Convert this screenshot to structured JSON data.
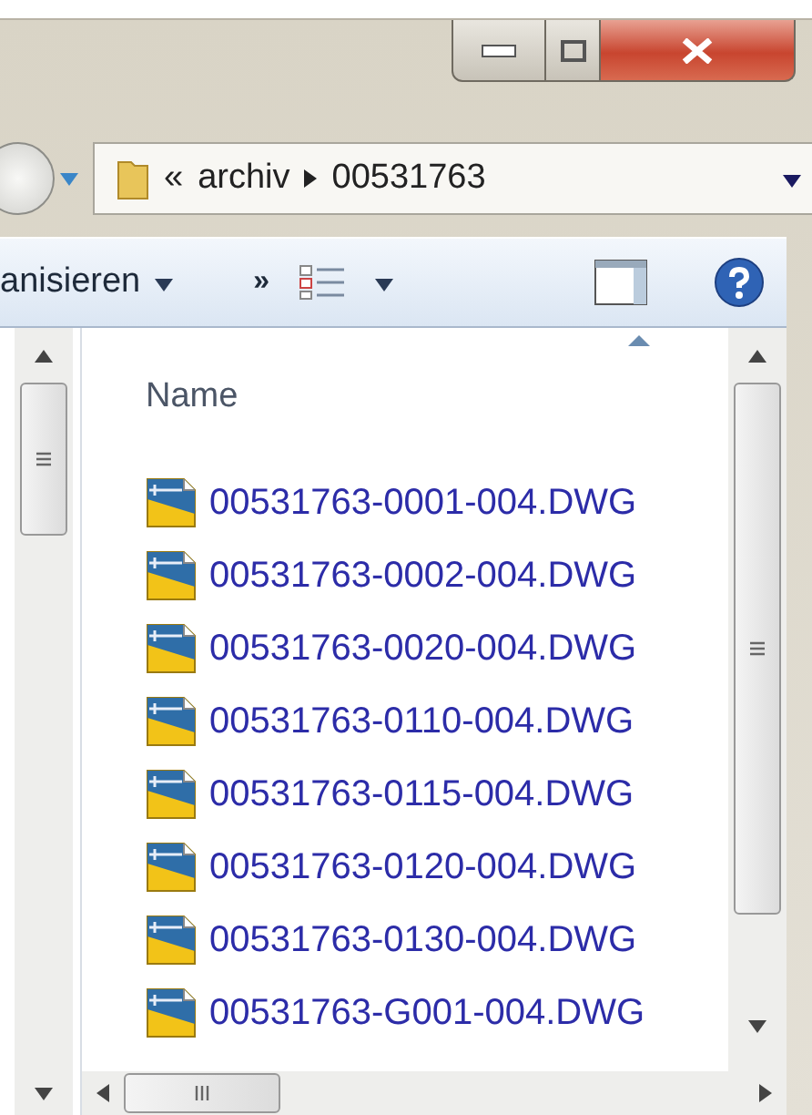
{
  "address": {
    "overflow": "«",
    "breadcrumbs": [
      "archiv",
      "00531763"
    ]
  },
  "toolbar": {
    "organize": "anisieren",
    "more": "»"
  },
  "list": {
    "column": "Name",
    "files": [
      {
        "name": "00531763-0001-004.DWG"
      },
      {
        "name": "00531763-0002-004.DWG"
      },
      {
        "name": "00531763-0020-004.DWG"
      },
      {
        "name": "00531763-0110-004.DWG"
      },
      {
        "name": "00531763-0115-004.DWG"
      },
      {
        "name": "00531763-0120-004.DWG"
      },
      {
        "name": "00531763-0130-004.DWG"
      },
      {
        "name": "00531763-G001-004.DWG"
      }
    ]
  }
}
